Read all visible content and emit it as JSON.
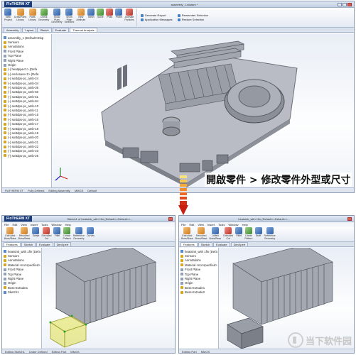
{
  "top": {
    "app_name": "FloTHERM XT",
    "title": "assembly_1.sldasm *",
    "ribbon": [
      {
        "label": "New\nProject",
        "icon": "new-project-icon",
        "tone": ""
      },
      {
        "label": "Draw/Parts\nLibrary",
        "icon": "library-icon",
        "tone": "o"
      },
      {
        "label": "Parts\nLibrary",
        "icon": "parts-icon",
        "tone": "o"
      },
      {
        "label": "Check\nGeometry",
        "icon": "check-icon",
        "tone": "g"
      },
      {
        "label": "Show\nPlain\nGeometry",
        "icon": "geometry-icon",
        "": ""
      },
      {
        "label": "Show\nPlain\nSelected",
        "icon": "selected-icon",
        "tone": ""
      },
      {
        "label": "New\nAttribute",
        "icon": "attribute-icon",
        "tone": "o"
      },
      {
        "label": "Mesh",
        "icon": "mesh-icon",
        "tone": ""
      },
      {
        "label": "Solve",
        "icon": "solve-icon",
        "tone": "g"
      },
      {
        "label": "Plots",
        "icon": "plots-icon",
        "tone": "r"
      },
      {
        "label": "Probe",
        "icon": "probe-icon",
        "tone": ""
      },
      {
        "label": "Animate\nParticles",
        "icon": "particles-icon",
        "tone": "r"
      }
    ],
    "ribbon_list_1": [
      "Generate Report",
      "Application Messages"
    ],
    "ribbon_list_2": [
      "Remember Selection",
      "Restore Selection"
    ],
    "tabs": [
      "Assembly",
      "Layout",
      "Sketch",
      "Evaluate",
      "Thermal Analysis"
    ],
    "active_tab": 4,
    "tree": [
      {
        "t": "assembly_1 (Default<Disp",
        "i": "b"
      },
      {
        "t": "Sensors",
        "i": "y"
      },
      {
        "t": "Annotations",
        "i": "y"
      },
      {
        "t": "Front Plane",
        "i": "l"
      },
      {
        "t": "Top Plane",
        "i": "l"
      },
      {
        "t": "Right Plane",
        "i": "l"
      },
      {
        "t": "Origin",
        "i": "l"
      },
      {
        "t": "(-) heatpipe<1> (Defa",
        "i": "y"
      },
      {
        "t": "(-) enclosure<1> (Defa",
        "i": "y"
      },
      {
        "t": "(-) sw3dps-pc_amb-24",
        "i": "y"
      },
      {
        "t": "(-) sw3dps-pc_amb-34",
        "i": "y"
      },
      {
        "t": "(-) sw3dps-pc_amb-35",
        "i": "y"
      },
      {
        "t": "(-) sw3dps-pc_amb-60",
        "i": "y"
      },
      {
        "t": "(-) sw3dps-pc_amb-61",
        "i": "y"
      },
      {
        "t": "(-) sw3dps-pc_amb-84",
        "i": "y"
      },
      {
        "t": "(-) sw3dps-pc_amb-10",
        "i": "y"
      },
      {
        "t": "(-) sw3dps-pc_amb-11",
        "i": "y"
      },
      {
        "t": "(-) sw3dps-pc_amb-15",
        "i": "y"
      },
      {
        "t": "(-) sw3dps-pc_amb-16",
        "i": "y"
      },
      {
        "t": "(-) sw3dps-pc_amb-17",
        "i": "y"
      },
      {
        "t": "(-) sw3dps-pc_amb-18",
        "i": "y"
      },
      {
        "t": "(-) sw3dps-pc_amb-19",
        "i": "y"
      },
      {
        "t": "(-) sw3dps-pc_amb-20",
        "i": "y"
      },
      {
        "t": "(-) sw3dps-pc_amb-21",
        "i": "y"
      },
      {
        "t": "(-) sw3dps-pc_amb-22",
        "i": "y"
      },
      {
        "t": "(-) sw3dps-pc_amb-23",
        "i": "y"
      },
      {
        "t": "(-) sw3dps-pc_amb-25",
        "i": "y"
      }
    ],
    "status": [
      "FloTHERM XT",
      "Fully Defined",
      "Editing Assembly",
      "MMGS",
      "Default"
    ],
    "view_tabs": [
      "Model",
      "Motion Study 1"
    ]
  },
  "caption": "開啟零件 > 修改零件外型或尺寸",
  "bottom_left": {
    "app_name": "FloTHERM XT",
    "title": "Sketch1 of heatsink_with 1fin (Default<<Default>>...",
    "menu": [
      "File",
      "Edit",
      "View",
      "Insert",
      "Tools",
      "Window",
      "Help"
    ],
    "ribbon": [
      {
        "label": "Extruded\nBoss/Base",
        "icon": "extrude-icon",
        "tone": "o"
      },
      {
        "label": "Revolved\nBoss/Base",
        "icon": "revolve-icon",
        "tone": "o"
      },
      {
        "label": "Swept",
        "icon": "swept-icon",
        "tone": ""
      },
      {
        "label": "Extruded\nCut",
        "icon": "cut-icon",
        "tone": "r"
      },
      {
        "label": "Fillet",
        "icon": "fillet-icon",
        "tone": ""
      },
      {
        "label": "Linear\nPattern",
        "icon": "pattern-icon",
        "tone": "g"
      },
      {
        "label": "Reference\nGeometry",
        "icon": "reference-icon",
        "tone": ""
      },
      {
        "label": "Curves",
        "icon": "curves-icon",
        "tone": ""
      }
    ],
    "tabs": [
      "Features",
      "Sketch",
      "Evaluate",
      "DimXpert"
    ],
    "tree": [
      {
        "t": "heatsink_with 1fin (Defa",
        "i": "b"
      },
      {
        "t": "Sensors",
        "i": "y"
      },
      {
        "t": "Annotations",
        "i": "y"
      },
      {
        "t": "Material <not specified>",
        "i": "y"
      },
      {
        "t": "Front Plane",
        "i": "l"
      },
      {
        "t": "Top Plane",
        "i": "l"
      },
      {
        "t": "Right Plane",
        "i": "l"
      },
      {
        "t": "Origin",
        "i": "l"
      },
      {
        "t": "Boss-Extrude1",
        "i": "y"
      },
      {
        "t": "Sketch1",
        "i": "b"
      }
    ],
    "status": [
      "Editing Sketch1",
      "Under Defined",
      "Editing Part",
      "MMGS"
    ]
  },
  "bottom_right": {
    "title": "heatsink_with 1fin (Default<<Default>>...",
    "menu": [
      "File",
      "Edit",
      "View",
      "Insert",
      "Tools",
      "Window",
      "Help"
    ],
    "ribbon": [
      {
        "label": "Extruded\nBoss/Base",
        "icon": "extrude-icon",
        "tone": "o"
      },
      {
        "label": "Revolved\nBoss/Base",
        "icon": "revolve-icon",
        "tone": "o"
      },
      {
        "label": "Lofted\nBoss/Base",
        "icon": "loft-icon",
        "tone": ""
      },
      {
        "label": "Extruded\nCut",
        "icon": "cut-icon",
        "tone": "r"
      },
      {
        "label": "Fillet",
        "icon": "fillet-icon",
        "tone": ""
      },
      {
        "label": "Linear\nPattern",
        "icon": "pattern-icon",
        "tone": "g"
      },
      {
        "label": "Draft",
        "icon": "draft-icon",
        "tone": ""
      },
      {
        "label": "Reference\nGeometry",
        "icon": "reference-icon",
        "tone": ""
      }
    ],
    "tabs": [
      "Features",
      "Sketch",
      "Evaluate",
      "DimXpert"
    ],
    "tree": [
      {
        "t": "heatsink_with 1fin (Defa",
        "i": "b"
      },
      {
        "t": "Sensors",
        "i": "y"
      },
      {
        "t": "Annotations",
        "i": "y"
      },
      {
        "t": "Material <not specified>",
        "i": "y"
      },
      {
        "t": "Front Plane",
        "i": "l"
      },
      {
        "t": "Top Plane",
        "i": "l"
      },
      {
        "t": "Right Plane",
        "i": "l"
      },
      {
        "t": "Origin",
        "i": "l"
      },
      {
        "t": "Boss-Extrude1",
        "i": "y"
      },
      {
        "t": "Boss-Extrude2",
        "i": "y"
      }
    ],
    "status": [
      "Editing Part",
      "MMGS"
    ]
  },
  "watermark": "当下软件园"
}
